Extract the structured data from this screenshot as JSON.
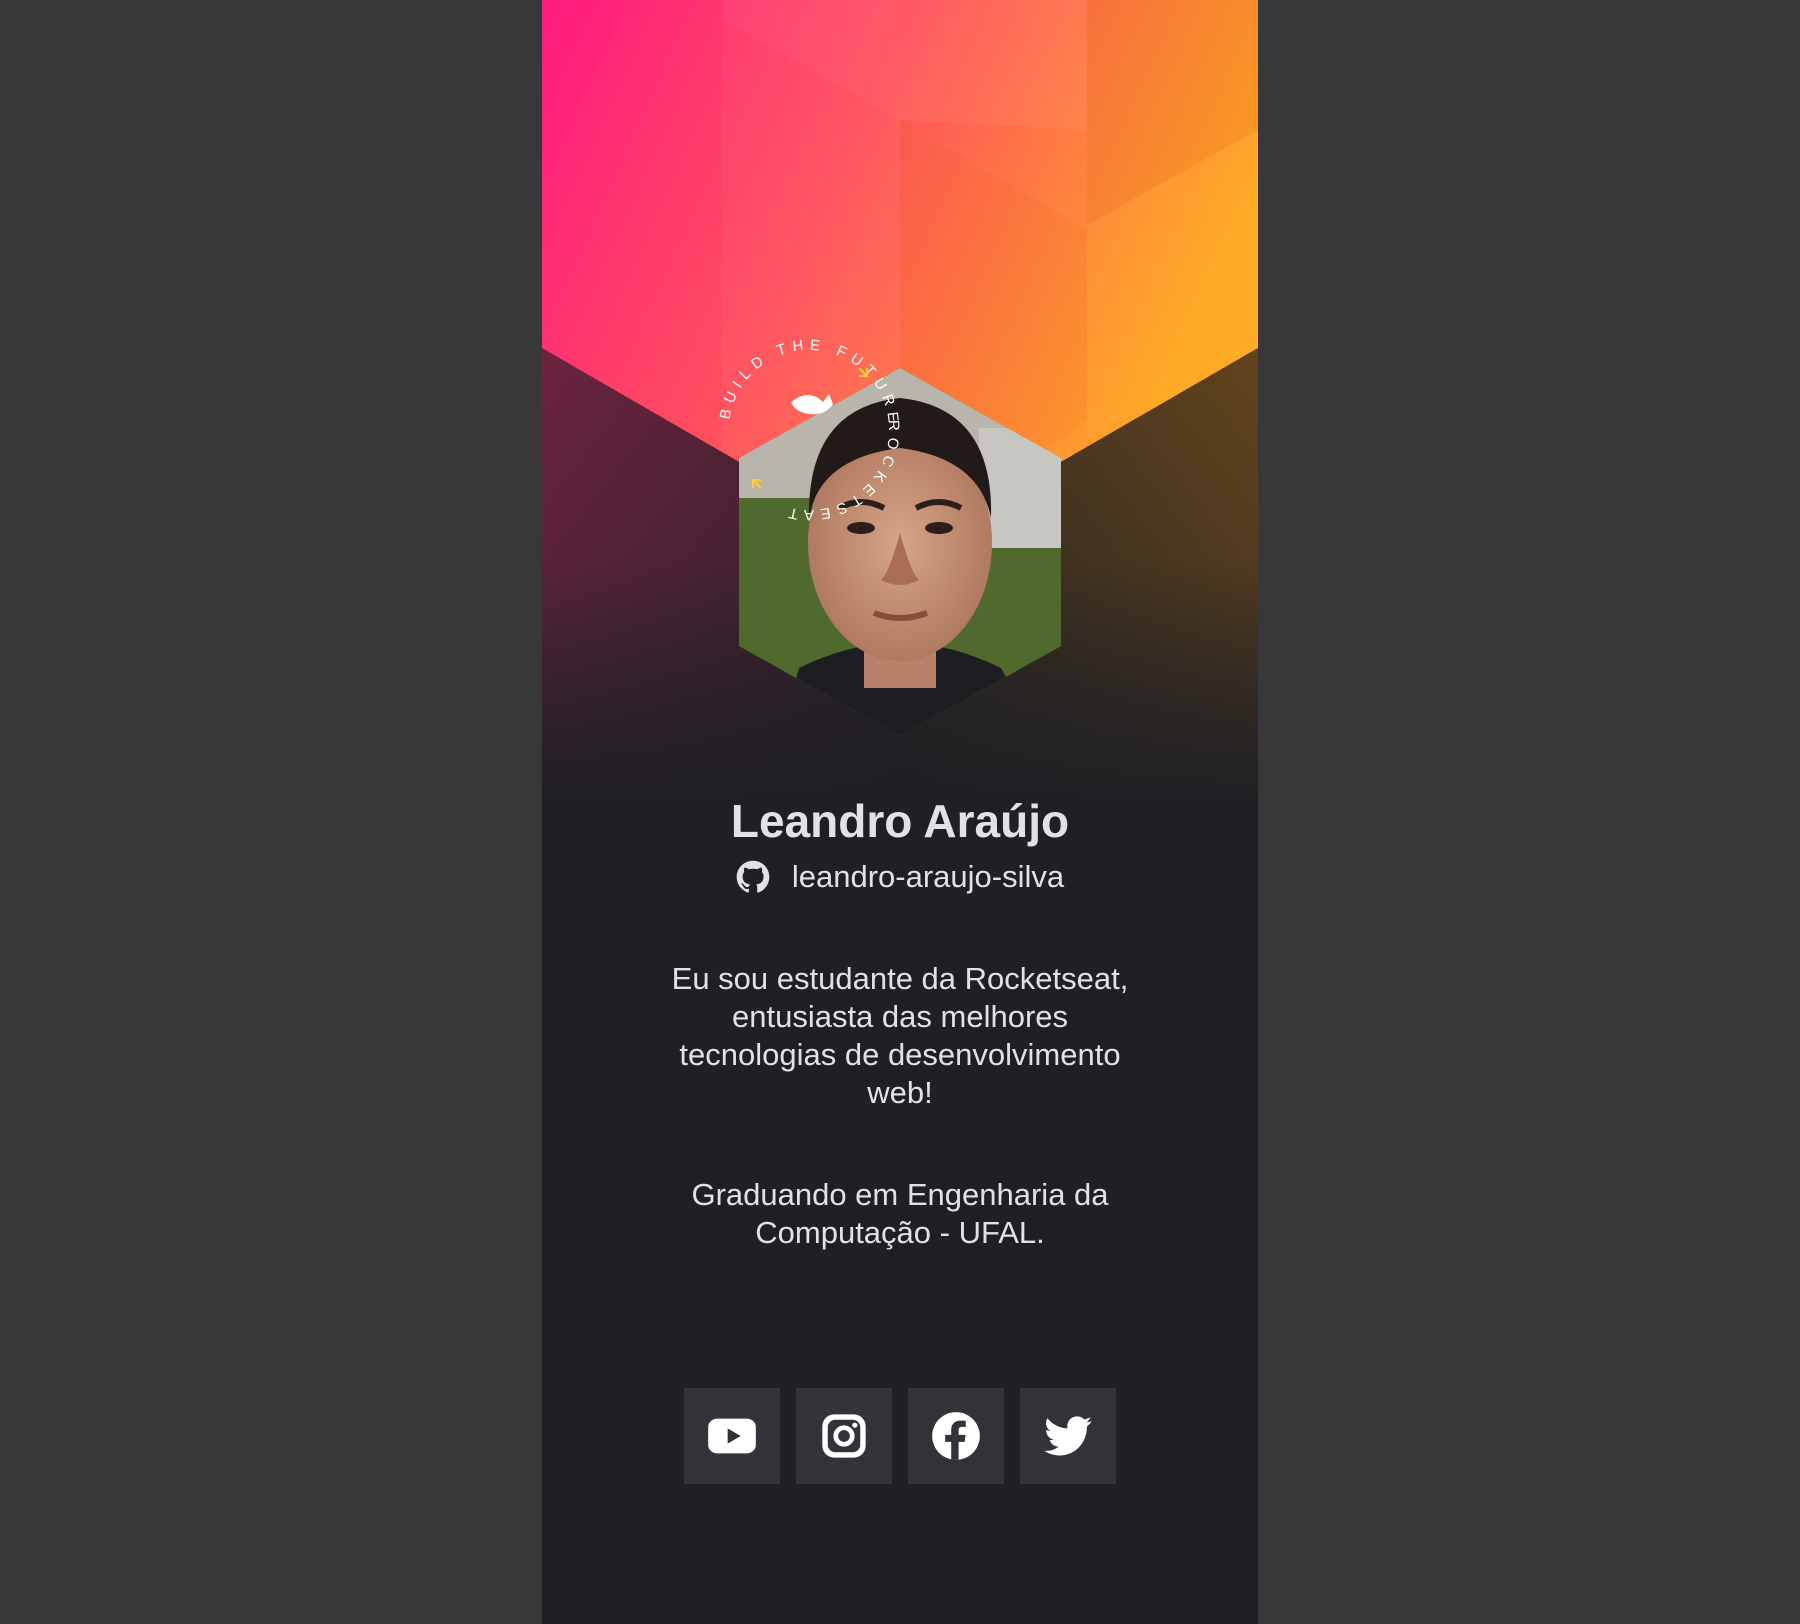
{
  "colors": {
    "page_background": "#38383a",
    "card_background": "#202024",
    "text": "#e1e1e6",
    "button_background": "#323238",
    "gradient_start": "#ff1a7f",
    "gradient_end": "#ffa726"
  },
  "badge": {
    "ring_text_top": "BUILD THE FUTURE",
    "ring_text_side": "ROCKETSEAT"
  },
  "profile": {
    "name": "Leandro Araújo",
    "github_user": "leandro-araujo-silva",
    "github_icon": "github-icon",
    "avatar_alt": "Leandro Araújo"
  },
  "bio": {
    "paragraph1": "Eu sou estudante da Rocketseat, entusiasta das melhores tecnologias de desenvolvimento web!",
    "paragraph2": "Graduando em Engenharia da Computação - UFAL."
  },
  "social_links": [
    {
      "name": "youtube",
      "icon": "youtube-icon"
    },
    {
      "name": "instagram",
      "icon": "instagram-icon"
    },
    {
      "name": "facebook",
      "icon": "facebook-icon"
    },
    {
      "name": "twitter",
      "icon": "twitter-icon"
    }
  ]
}
